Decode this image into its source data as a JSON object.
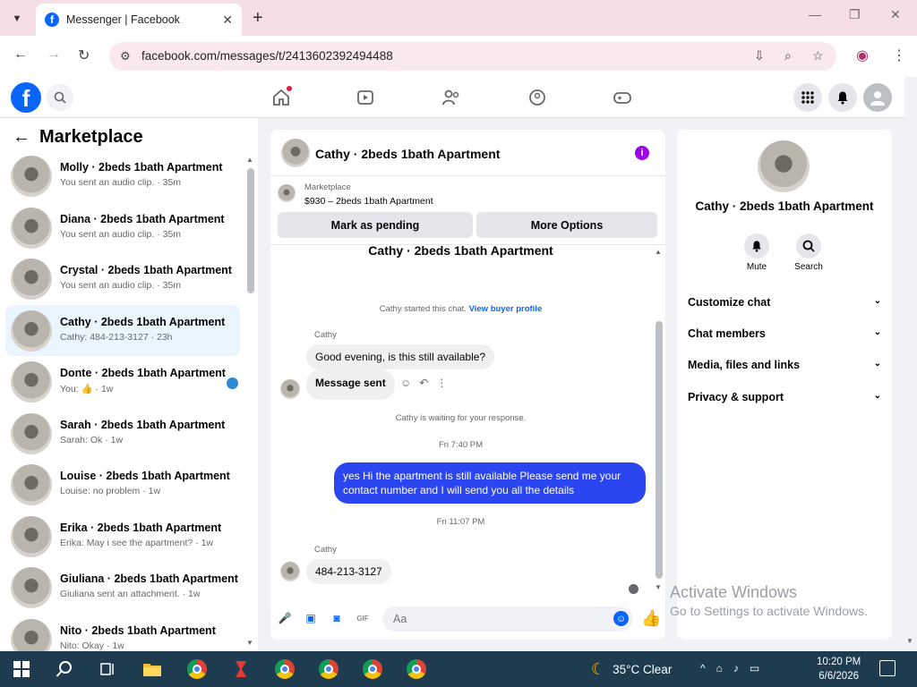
{
  "browser": {
    "tab_title": "Messenger | Facebook",
    "url": "facebook.com/messages/t/2413602392494488"
  },
  "sidebar": {
    "title": "Marketplace",
    "conversations": [
      {
        "name": "Molly · 2beds 1bath Apartment",
        "snippet": "You sent an audio clip. · 35m"
      },
      {
        "name": "Diana · 2beds 1bath Apartment",
        "snippet": "You sent an audio clip. · 35m"
      },
      {
        "name": "Crystal · 2beds 1bath Apartment",
        "snippet": "You sent an audio clip. · 35m"
      },
      {
        "name": "Cathy · 2beds 1bath Apartment",
        "snippet": "Cathy: 484-213-3127 · 23h"
      },
      {
        "name": "Donte · 2beds 1bath Apartment",
        "snippet": "You: 👍 · 1w"
      },
      {
        "name": "Sarah · 2beds 1bath Apartment",
        "snippet": "Sarah: Ok · 1w"
      },
      {
        "name": "Louise · 2beds 1bath Apartment",
        "snippet": "Louise: no problem · 1w"
      },
      {
        "name": "Erika · 2beds 1bath Apartment",
        "snippet": "Erika: May i see the apartment? · 1w"
      },
      {
        "name": "Giuliana · 2beds 1bath Apartment",
        "snippet": "Giuliana sent an attachment. · 1w"
      },
      {
        "name": "Nito · 2beds 1bath Apartment",
        "snippet": "Nito: Okay · 1w"
      }
    ]
  },
  "chat": {
    "header_name": "Cathy · 2beds 1bath Apartment",
    "marketplace_label": "Marketplace",
    "listing": "$930 – 2beds 1bath Apartment",
    "mark_pending": "Mark as pending",
    "more_options": "More Options",
    "center_title": "Cathy · 2beds 1bath Apartment",
    "started_text": "Cathy started this chat.",
    "view_profile": "View buyer profile",
    "sender_1": "Cathy",
    "msg_1": "Good evening, is this still available?",
    "msg_2": "Message sent",
    "waiting": "Cathy is waiting for your response.",
    "time_1": "Fri 7:40 PM",
    "msg_out": "yes Hi the apartment is still available Please send me your contact number and I will send you all the details",
    "time_2": "Fri 11:07 PM",
    "sender_2": "Cathy",
    "msg_3": "484-213-3127",
    "input_placeholder": "Aa"
  },
  "info": {
    "name": "Cathy · 2beds 1bath Apartment",
    "mute": "Mute",
    "search": "Search",
    "sections": [
      "Customize chat",
      "Chat members",
      "Media, files and links",
      "Privacy & support"
    ]
  },
  "watermark": {
    "line1": "Activate Windows",
    "line2": "Go to Settings to activate Windows."
  },
  "taskbar": {
    "weather": "35°C  Clear",
    "time": "10:20 PM",
    "date": "6/6/2026"
  },
  "colors": {
    "fb_blue": "#0866ff",
    "outgoing_bubble": "#2b45f0",
    "active_conv": "#ebf5ff",
    "info_icon": "#9b00e8"
  }
}
